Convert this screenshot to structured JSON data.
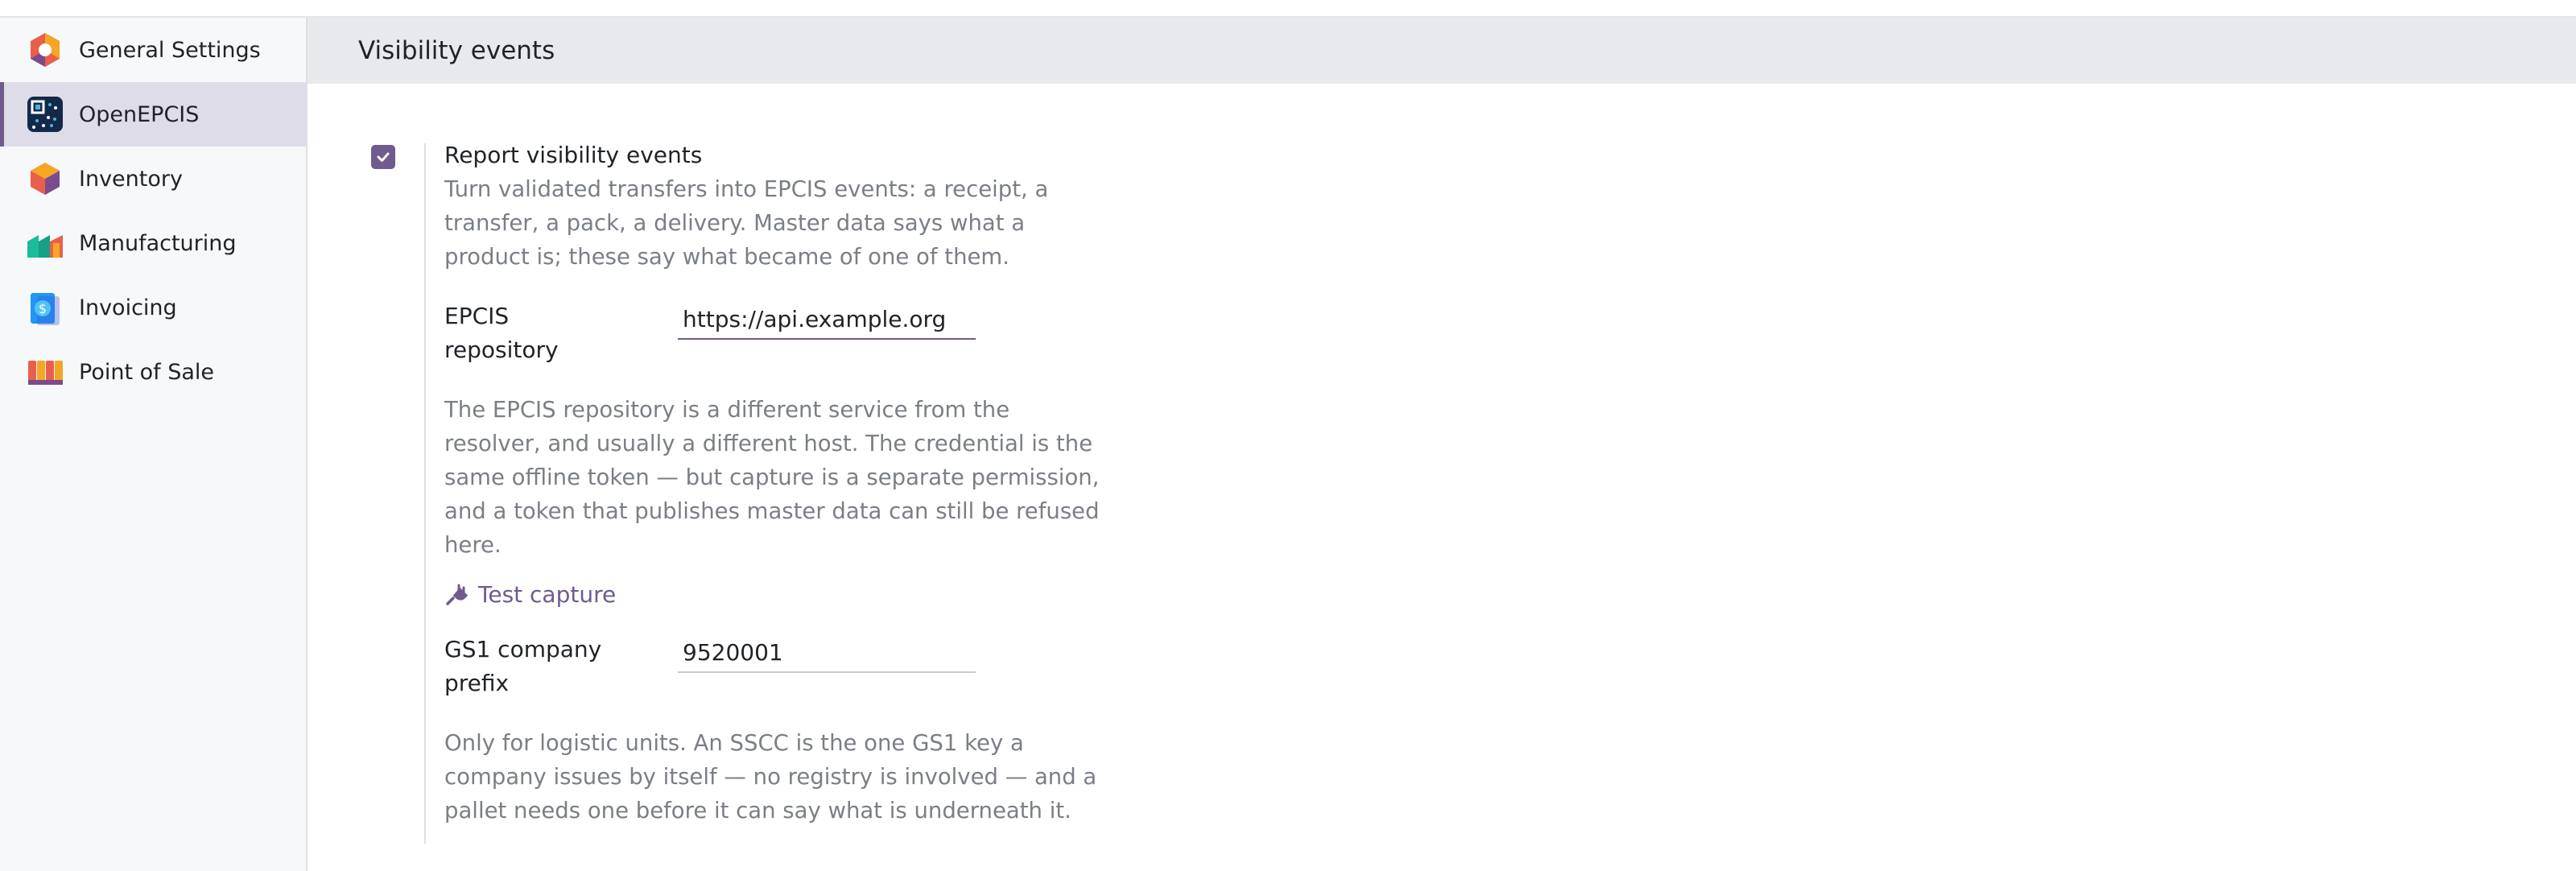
{
  "sidebar": {
    "items": [
      {
        "label": "General Settings",
        "icon": "general-settings-icon",
        "active": false
      },
      {
        "label": "OpenEPCIS",
        "icon": "openepcis-icon",
        "active": true
      },
      {
        "label": "Inventory",
        "icon": "inventory-icon",
        "active": false
      },
      {
        "label": "Manufacturing",
        "icon": "manufacturing-icon",
        "active": false
      },
      {
        "label": "Invoicing",
        "icon": "invoicing-icon",
        "active": false
      },
      {
        "label": "Point of Sale",
        "icon": "point-of-sale-icon",
        "active": false
      }
    ]
  },
  "section": {
    "title": "Visibility events"
  },
  "setting": {
    "checked": true,
    "title": "Report visibility events",
    "description": "Turn validated transfers into EPCIS events: a receipt, a transfer, a pack, a delivery. Master data says what a product is; these say what became of one of them.",
    "repository": {
      "label": "EPCIS repository",
      "value": "https://api.example.org",
      "help": "The EPCIS repository is a different service from the resolver, and usually a different host. The credential is the same offline token — but capture is a separate permission, and a token that publishes master data can still be refused here."
    },
    "test_capture_label": "Test capture",
    "company_prefix": {
      "label": "GS1 company prefix",
      "value": "9520001",
      "help": "Only for logistic units. An SSCC is the one GS1 key a company issues by itself — no registry is involved — and a pallet needs one before it can say what is underneath it."
    }
  },
  "colors": {
    "accent": "#6f5b8e",
    "header_bg": "#e7e9ec",
    "sidebar_bg": "#f7f8fa",
    "active_bg": "#dedce8",
    "muted_text": "#7a7f86"
  }
}
